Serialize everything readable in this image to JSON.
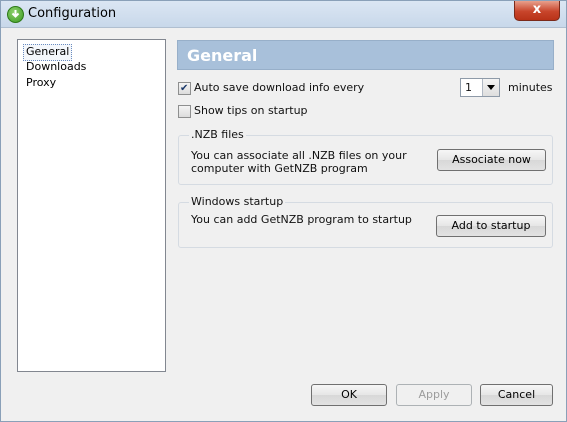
{
  "window": {
    "title": "Configuration",
    "close_glyph": "x"
  },
  "sidebar": {
    "items": [
      {
        "label": "General",
        "selected": true
      },
      {
        "label": "Downloads",
        "selected": false
      },
      {
        "label": "Proxy",
        "selected": false
      }
    ]
  },
  "header": {
    "title": "General"
  },
  "options": {
    "autosave": {
      "label": "Auto save download info every",
      "checked": true
    },
    "interval": {
      "value": "1",
      "unit": "minutes"
    },
    "show_tips": {
      "label": "Show tips on startup",
      "checked": false
    }
  },
  "nzb_group": {
    "title": ".NZB files",
    "text_line1": "You can associate all .NZB files on your",
    "text_line2": "computer with GetNZB program",
    "button": "Associate now"
  },
  "startup_group": {
    "title": "Windows startup",
    "text": "You can add GetNZB program to startup",
    "button": "Add to startup"
  },
  "footer": {
    "ok": "OK",
    "apply": "Apply",
    "cancel": "Cancel"
  },
  "colors": {
    "header_band": "#a8c0da",
    "close_button": "#c8452b",
    "app_icon": "#3a9a1f"
  }
}
